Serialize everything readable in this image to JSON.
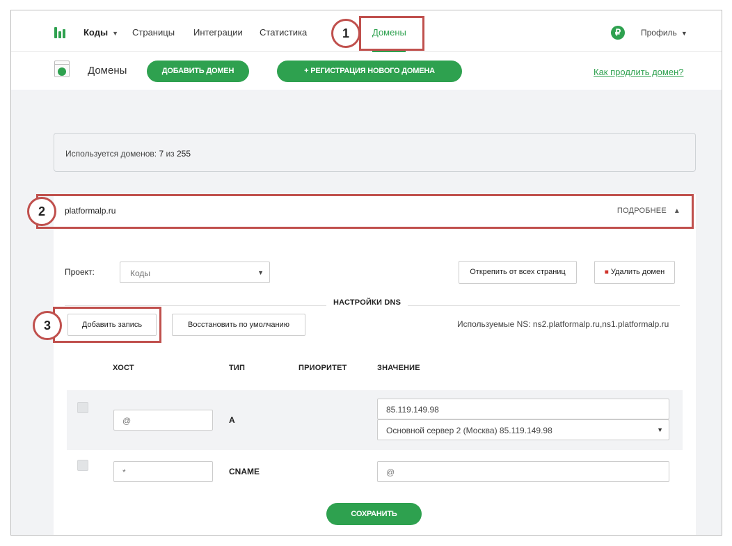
{
  "nav": {
    "items": [
      {
        "label": "Коды",
        "has_caret": true
      },
      {
        "label": "Страницы"
      },
      {
        "label": "Интеграции"
      },
      {
        "label": "Статистика"
      },
      {
        "label": "Домены",
        "active": true
      }
    ],
    "caret": "▼",
    "currency_symbol": "₽",
    "profile_label": "Профиль",
    "accent_color": "#2ea14f"
  },
  "subheader": {
    "title": "Домены",
    "add_domain_label": "ДОБАВИТЬ ДОМЕН",
    "register_label": "+ РЕГИСТРАЦИЯ НОВОГО ДОМЕНА",
    "help_link": "Как продлить домен?"
  },
  "usage": {
    "prefix": "Используется доменов: ",
    "used": "7",
    "sep": " из ",
    "total": "255"
  },
  "domain": {
    "name": "platformalp.ru",
    "details_label": "ПОДРОБНЕЕ",
    "details_icon": "▲",
    "project_label": "Проект:",
    "project_value": "Коды",
    "unpin_label": "Открепить от всех страниц",
    "delete_label": "Удалить домен",
    "dns_title": "НАСТРОЙКИ DNS",
    "add_record_label": "Добавить запись",
    "restore_label": "Восстановить по умолчанию",
    "ns_text": "Используемые NS: ns2.platformalp.ru,ns1.platformalp.ru",
    "columns": [
      "ХОСТ",
      "ТИП",
      "ПРИОРИТЕТ",
      "ЗНАЧЕНИЕ"
    ],
    "records": [
      {
        "host": "@",
        "type": "A",
        "value": "85.119.149.98",
        "server": "Основной сервер 2 (Москва) 85.119.149.98"
      },
      {
        "host": "*",
        "type": "CNAME",
        "value": "@"
      }
    ],
    "save_label": "СОХРАНИТЬ"
  },
  "annotations": [
    "1",
    "2",
    "3"
  ],
  "annotation_color": "#c0504d"
}
